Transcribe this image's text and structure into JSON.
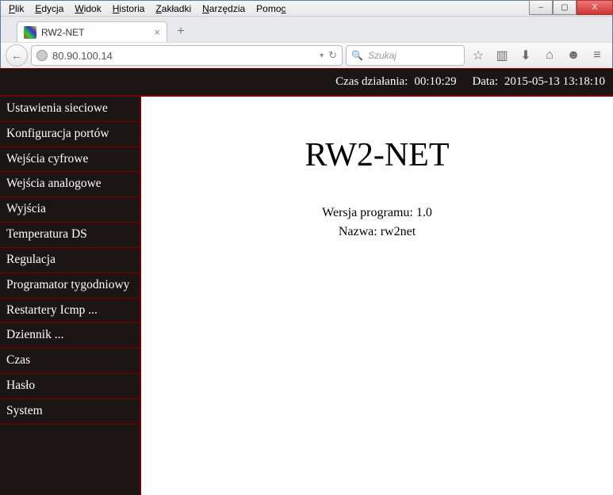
{
  "menubar": {
    "items": [
      "Plik",
      "Edycja",
      "Widok",
      "Historia",
      "Zakładki",
      "Narzędzia",
      "Pomoc"
    ]
  },
  "window_controls": {
    "min": "–",
    "max": "▢",
    "close": "X"
  },
  "tab": {
    "title": "RW2-NET"
  },
  "navbar": {
    "url": "80.90.100.14",
    "search_placeholder": "Szukaj"
  },
  "topstrip": {
    "uptime_label": "Czas działania:",
    "uptime": "00:10:29",
    "date_label": "Data:",
    "date": "2015-05-13 13:18:10"
  },
  "sidebar": {
    "items": [
      "Ustawienia sieciowe",
      "Konfiguracja portów",
      "Wejścia cyfrowe",
      "Wejścia analogowe",
      "Wyjścia",
      "Temperatura DS",
      "Regulacja",
      "Programator tygodniowy",
      "Restartery Icmp ...",
      "Dziennik ...",
      "Czas",
      "Hasło",
      "System"
    ]
  },
  "main": {
    "title": "RW2-NET",
    "version_label": "Wersja programu:",
    "version": "1.0",
    "name_label": "Nazwa:",
    "name": "rw2net"
  }
}
